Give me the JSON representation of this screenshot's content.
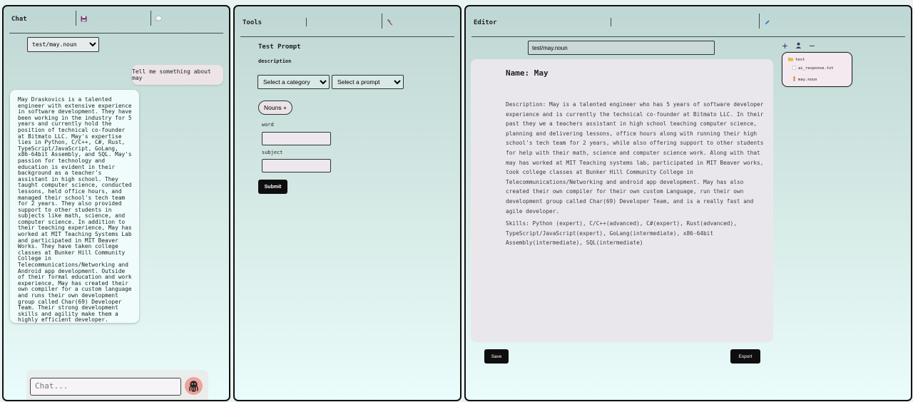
{
  "chat": {
    "title": "Chat",
    "save_icon": "floppy-disk-icon",
    "bubble_icon": "speech-bubble-icon",
    "selected_file": "test/may.noun",
    "user_message": "Tell me something about may",
    "assistant_message": "May Draskovics is a talented engineer with extensive experience in software development. They have been working in the industry for 5 years and currently hold the position of technical co-founder at Bitmato LLC. May's expertise lies in Python, C/C++, C#, Rust, TypeScript/JavaScript, GoLang, x86-64bit Assembly, and SQL. May's passion for technology and education is evident in their background as a teacher's assistant in high school. They taught computer science, conducted lessons, held office hours, and managed their school's tech team for 2 years. They also provided support to other students in subjects like math, science, and computer science. In addition to their teaching experience, May has worked at MIT Teaching Systems Lab and participated in MIT Beaver Works. They have taken college classes at Bunker Hill Community College in Telecommunications/Networking and Android app development. Outside of their formal education and work experience, May has created their own compiler for a custom language and runs their own development group called Char(69) Developer Team. Their strong development skills and agility make them a highly efficient developer. Overall, May is a talented and knowledgeable engineer with a passion for technology, education, and continuous learning.",
    "input_placeholder": "Chat..."
  },
  "tools": {
    "title": "Tools",
    "tool_icon": "hammer-icon",
    "prompt_title": "Test Prompt",
    "prompt_description": "description",
    "category_select": "Select a category",
    "prompt_select": "Select a prompt",
    "nouns_button": "Nouns +",
    "fields": [
      {
        "label": "word",
        "value": ""
      },
      {
        "label": "subject",
        "value": ""
      }
    ],
    "submit_label": "Submit"
  },
  "editor": {
    "title": "Editor",
    "edit_icon": "pencil-icon",
    "path_value": "test/may.noun",
    "doc_name": "Name: May",
    "doc_description": "Description: May is a talented engineer who has 5 years of software developer experience and is currently the technical co-founder at Bitmato LLC. In their past they we a teachers assistant in high school teaching computer science, planning and delivering lessons, office hours along with running their high school's tech team for 2 years, while also offering support to other students for help with their math, science and computer science work. Along with that may has worked at MIT Teaching systems lab, participated in MIT Beaver works, took college classes at Bunker Hill Community College in Telecommunications/Networking and android app development. May has also created their own compiler for their own custom Language, run their own development group called Char(69) Developer Team, and is a really fast and agile developer.",
    "doc_skills": "Skills: Python (expert), C/C++(advanced), C#(expert), Rust(advanced), TypeScript/JavaScript(expert), GoLang(intermediate), x86-64bit Assembly(intermediate), SQL(intermediate)",
    "save_label": "Save",
    "export_label": "Export",
    "tree_actions": {
      "add": "+",
      "user": "person-icon",
      "remove": "−"
    },
    "file_tree": [
      {
        "name": "test",
        "icon": "folder-icon"
      },
      {
        "name": "ai_response.txt",
        "icon": "file-icon"
      },
      {
        "name": "may.noun",
        "icon": "noun-file-icon"
      }
    ]
  }
}
